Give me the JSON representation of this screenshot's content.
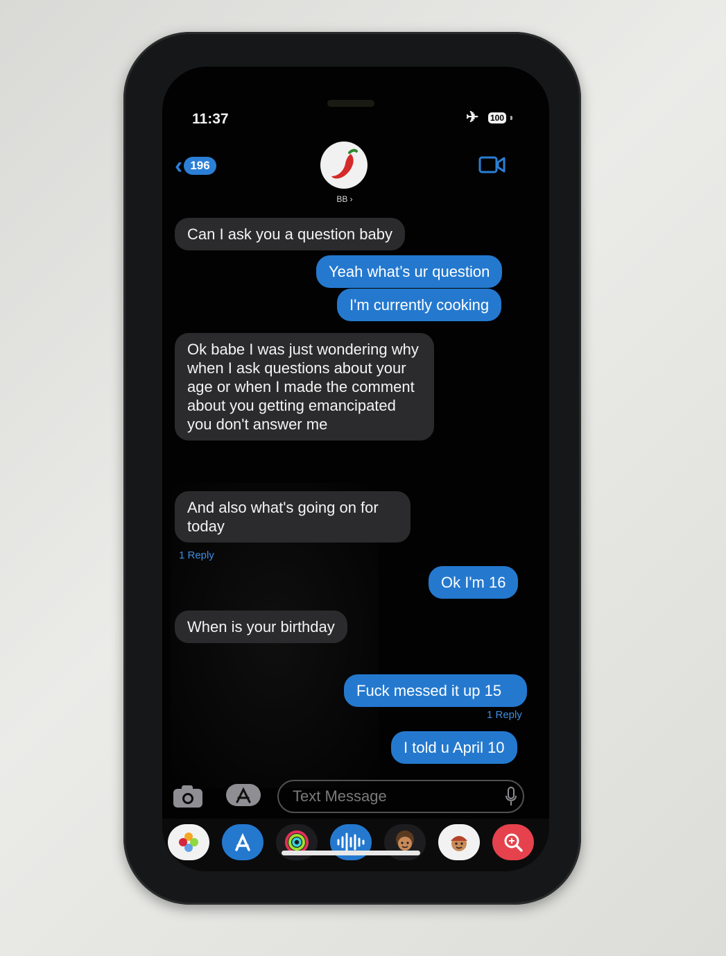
{
  "status_bar": {
    "time": "11:37",
    "battery": "100"
  },
  "header": {
    "back_count": "196",
    "contact_name": "BB ›"
  },
  "messages": [
    {
      "text": "Can I ask you a question baby"
    },
    {
      "text": "Yeah what’s ur question"
    },
    {
      "text": "I'm currently cooking"
    },
    {
      "text": "Ok babe I was just wondering why when I ask questions about your age or when I made the comment about you getting emancipated you don't answer me"
    },
    {
      "text": "And also what's going on for today",
      "reply": "1 Reply"
    },
    {
      "text": "Ok I'm 16"
    },
    {
      "text": "When is your birthday"
    },
    {
      "text": "Fuck messed it up 15",
      "reply": "1 Reply"
    },
    {
      "text": "I told u April 10"
    }
  ],
  "compose": {
    "placeholder": "Text Message"
  },
  "app_drawer": [
    "photos-icon",
    "app-store-icon",
    "fitness-icon",
    "audio-icon",
    "memoji-icon",
    "memoji-sticker-icon",
    "search-images-icon"
  ],
  "colors": {
    "outgoing": "#2479cf",
    "incoming": "#2b2b2d",
    "accent": "#2b7fd6"
  }
}
